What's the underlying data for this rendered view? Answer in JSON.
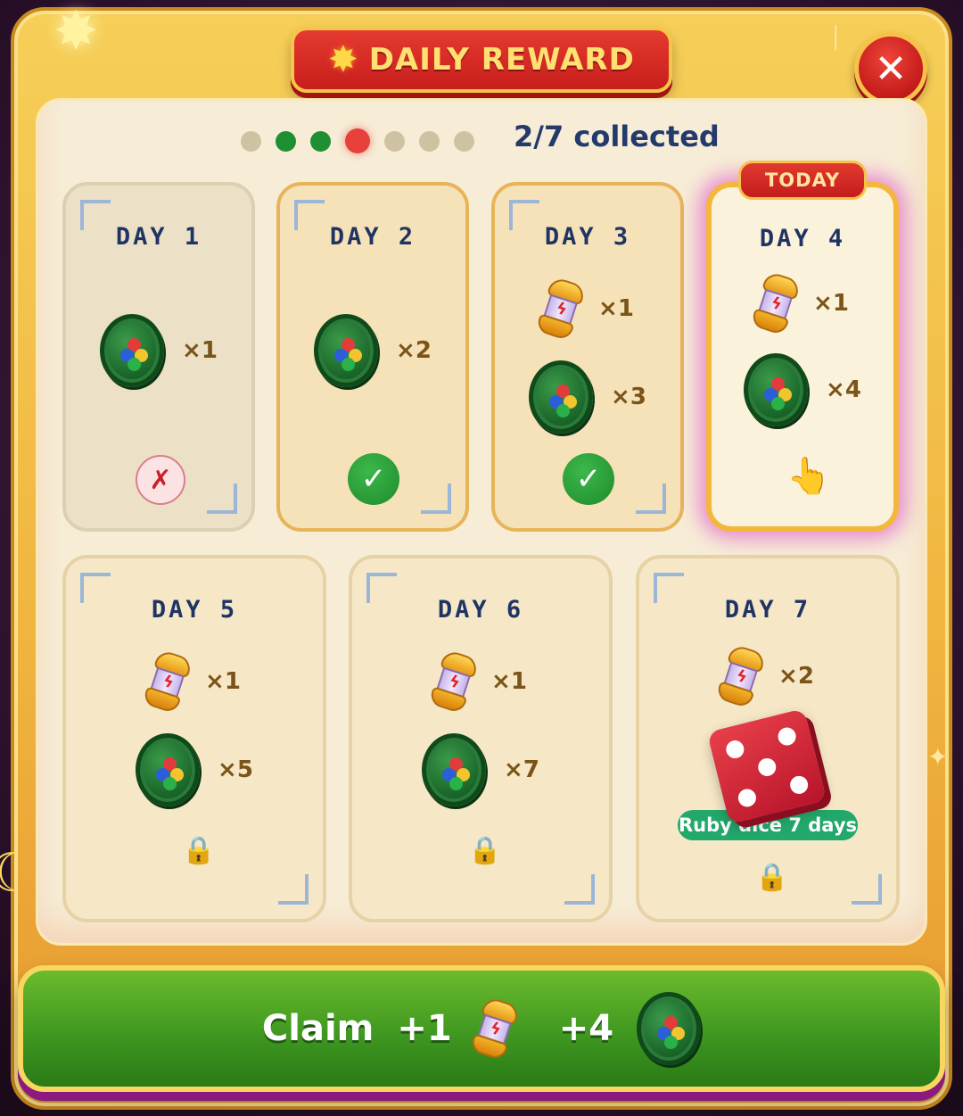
{
  "title": {
    "text": "DAILY REWARD",
    "star_icon": "star-icon"
  },
  "close": {
    "icon": "close-icon",
    "glyph": "✕"
  },
  "progress": {
    "collected_text": "2/7 collected",
    "collected": 2,
    "total": 7,
    "current_day": 4,
    "dots": [
      "missed",
      "done",
      "done",
      "current",
      "locked",
      "locked",
      "locked"
    ]
  },
  "days": [
    {
      "label": "DAY 1",
      "status": "missed",
      "status_glyph": "✗",
      "rewards": [
        {
          "item": "coin",
          "qty": "×1"
        }
      ]
    },
    {
      "label": "DAY 2",
      "status": "claimed",
      "status_glyph": "✓",
      "rewards": [
        {
          "item": "coin",
          "qty": "×2"
        }
      ]
    },
    {
      "label": "DAY 3",
      "status": "claimed",
      "status_glyph": "✓",
      "rewards": [
        {
          "item": "capsule",
          "qty": "×1"
        },
        {
          "item": "coin",
          "qty": "×3"
        }
      ]
    },
    {
      "label": "DAY 4",
      "status": "today",
      "status_glyph": "👆",
      "badge": "TODAY",
      "rewards": [
        {
          "item": "capsule",
          "qty": "×1"
        },
        {
          "item": "coin",
          "qty": "×4"
        }
      ]
    },
    {
      "label": "DAY 5",
      "status": "locked",
      "status_glyph": "🔒",
      "rewards": [
        {
          "item": "capsule",
          "qty": "×1"
        },
        {
          "item": "coin",
          "qty": "×5"
        }
      ]
    },
    {
      "label": "DAY 6",
      "status": "locked",
      "status_glyph": "🔒",
      "rewards": [
        {
          "item": "capsule",
          "qty": "×1"
        },
        {
          "item": "coin",
          "qty": "×7"
        }
      ]
    },
    {
      "label": "DAY 7",
      "status": "locked",
      "status_glyph": "🔒",
      "rewards": [
        {
          "item": "capsule",
          "qty": "×2"
        },
        {
          "item": "dice",
          "label": "Ruby dice 7 days"
        }
      ]
    }
  ],
  "claim": {
    "label": "Claim",
    "capsule_amount": "+1",
    "coin_amount": "+4"
  },
  "colors": {
    "frame": "#f0b640",
    "title_red": "#c81e1c",
    "claim_green": "#3f9820",
    "day_text": "#203463",
    "today_glow": "#dc3cc8"
  }
}
